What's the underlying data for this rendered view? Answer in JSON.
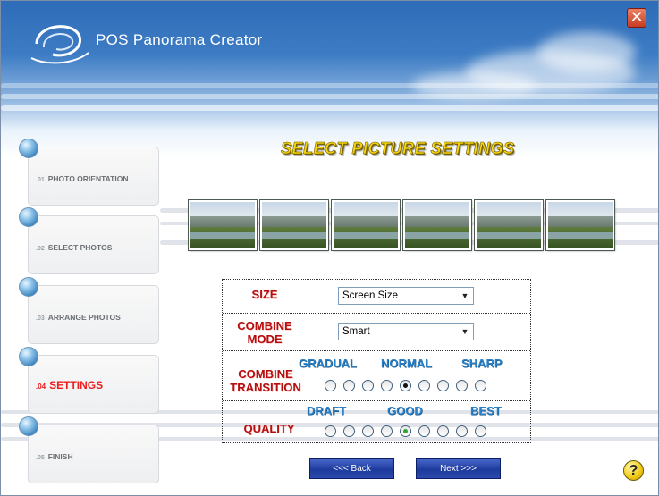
{
  "window": {
    "title": "POS Panorama Creator",
    "close_glyph": "✕"
  },
  "steps": [
    {
      "num": ".01",
      "label": "PHOTO ORIENTATION",
      "active": false
    },
    {
      "num": ".02",
      "label": "SELECT PHOTOS",
      "active": false
    },
    {
      "num": ".03",
      "label": "ARRANGE PHOTOS",
      "active": false
    },
    {
      "num": ".04",
      "label": "SETTINGS",
      "active": true
    },
    {
      "num": ".05",
      "label": "FINISH",
      "active": false
    }
  ],
  "heading": "SELECT PICTURE SETTINGS",
  "settings": {
    "size": {
      "label": "SIZE",
      "value": "Screen Size"
    },
    "combine_mode": {
      "label_line1": "COMBINE",
      "label_line2": "MODE",
      "value": "Smart"
    },
    "combine_transition": {
      "label_line1": "COMBINE",
      "label_line2": "TRANSITION",
      "scale": [
        "GRADUAL",
        "NORMAL",
        "SHARP"
      ],
      "options_count": 9,
      "selected_index": 4
    },
    "quality": {
      "label": "QUALITY",
      "scale": [
        "DRAFT",
        "GOOD",
        "BEST"
      ],
      "options_count": 9,
      "selected_index": 4
    }
  },
  "buttons": {
    "back": "<<< Back",
    "next": "Next >>>"
  },
  "help": {
    "glyph": "?"
  },
  "icons": {
    "logo": "app-logo-swirl",
    "close": "close-icon",
    "help": "help-icon",
    "step": "step-bubble-icon"
  },
  "colors": {
    "accent_red": "#b50f0f",
    "heading_yellow": "#f7d60c",
    "scale_blue": "#2b7fc4",
    "button_blue": "#1d3a9c"
  }
}
